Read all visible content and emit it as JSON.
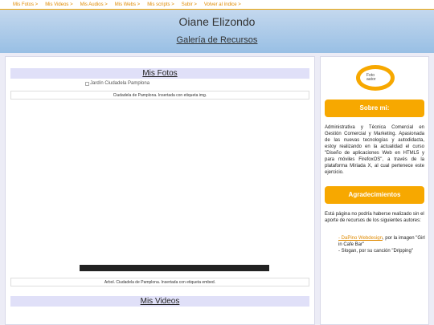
{
  "nav": {
    "items": [
      "Mis Fotos >",
      "Mis Videos >",
      "Mis Audios >",
      "Mis Webs >",
      "Mis scripts >",
      "Subir >",
      "Volver al índice >"
    ]
  },
  "header": {
    "title": "Oiane Elizondo",
    "subtitle": "Galería de Recursos"
  },
  "main": {
    "fotos_heading": "Mis Fotos",
    "img_alt": "Jardín Ciudadela Pamplona",
    "img_caption": "Ciudadela de Pamplona. Insertada con etiqueta img.",
    "embed_caption": "Arbol. Ciudadela de Pamplona. Insertada con etiqueta embed.",
    "videos_heading": "Mis Videos"
  },
  "sidebar": {
    "avatar_alt": "Foto autor",
    "about_heading": "Sobre mi:",
    "about_text": "Administrativa y Técnica Comercial en Gestión Comercial y Marketing. Apasionada de las nuevas tecnologías y autodidacta, estoy realizando en la actualidad el curso \"Diseño de aplicaciones Web en HTML5 y para móviles FirefoxOS\", a través de la plataforma Miriada X, al cual pertenece este ejercicio.",
    "thanks_heading": "Agradecimientos",
    "thanks_text": "Está página no podría haberse realizado sin el aporte de recursos de los siguientes autores:",
    "credit1_link": "- DaPino Webdesign",
    "credit1_rest": ", por la imagen \"Girl in Cafe Bar\"",
    "credit2": "- Slogan, por su canción \"Dripping\""
  },
  "colors": {
    "accent": "#f7a800",
    "header_gradient": [
      "#c4d8ee",
      "#98bfe4"
    ],
    "section_band": "#e0e0f8"
  }
}
